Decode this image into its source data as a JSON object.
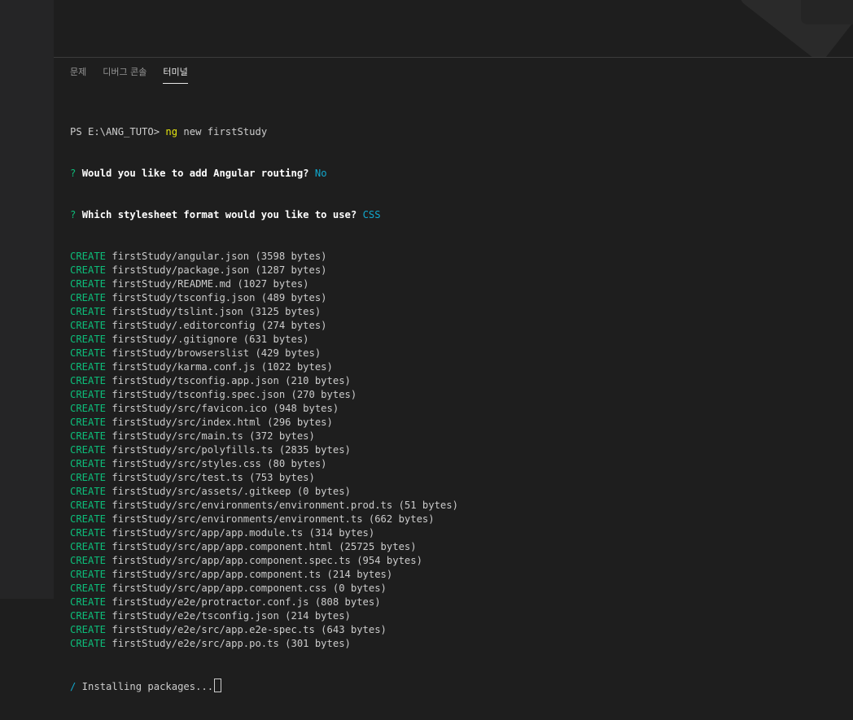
{
  "panel": {
    "tabs": [
      {
        "label": "문제",
        "active": false
      },
      {
        "label": "디버그 콘솔",
        "active": false
      },
      {
        "label": "터미널",
        "active": true
      }
    ]
  },
  "terminal": {
    "prompt": "PS E:\\ANG_TUTO> ",
    "command_name": "ng",
    "command_args": " new firstStudy",
    "questions": [
      {
        "mark": "? ",
        "text": "Would you like to add Angular routing?",
        "answer": "No"
      },
      {
        "mark": "? ",
        "text": "Which stylesheet format would you like to use?",
        "answer": "CSS"
      }
    ],
    "create_label": "CREATE",
    "create_lines": [
      "firstStudy/angular.json (3598 bytes)",
      "firstStudy/package.json (1287 bytes)",
      "firstStudy/README.md (1027 bytes)",
      "firstStudy/tsconfig.json (489 bytes)",
      "firstStudy/tslint.json (3125 bytes)",
      "firstStudy/.editorconfig (274 bytes)",
      "firstStudy/.gitignore (631 bytes)",
      "firstStudy/browserslist (429 bytes)",
      "firstStudy/karma.conf.js (1022 bytes)",
      "firstStudy/tsconfig.app.json (210 bytes)",
      "firstStudy/tsconfig.spec.json (270 bytes)",
      "firstStudy/src/favicon.ico (948 bytes)",
      "firstStudy/src/index.html (296 bytes)",
      "firstStudy/src/main.ts (372 bytes)",
      "firstStudy/src/polyfills.ts (2835 bytes)",
      "firstStudy/src/styles.css (80 bytes)",
      "firstStudy/src/test.ts (753 bytes)",
      "firstStudy/src/assets/.gitkeep (0 bytes)",
      "firstStudy/src/environments/environment.prod.ts (51 bytes)",
      "firstStudy/src/environments/environment.ts (662 bytes)",
      "firstStudy/src/app/app.module.ts (314 bytes)",
      "firstStudy/src/app/app.component.html (25725 bytes)",
      "firstStudy/src/app/app.component.spec.ts (954 bytes)",
      "firstStudy/src/app/app.component.ts (214 bytes)",
      "firstStudy/src/app/app.component.css (0 bytes)",
      "firstStudy/e2e/protractor.conf.js (808 bytes)",
      "firstStudy/e2e/tsconfig.json (214 bytes)",
      "firstStudy/e2e/src/app.e2e-spec.ts (643 bytes)",
      "firstStudy/e2e/src/app.po.ts (301 bytes)"
    ],
    "spinner": "/",
    "status_text": " Installing packages..."
  }
}
